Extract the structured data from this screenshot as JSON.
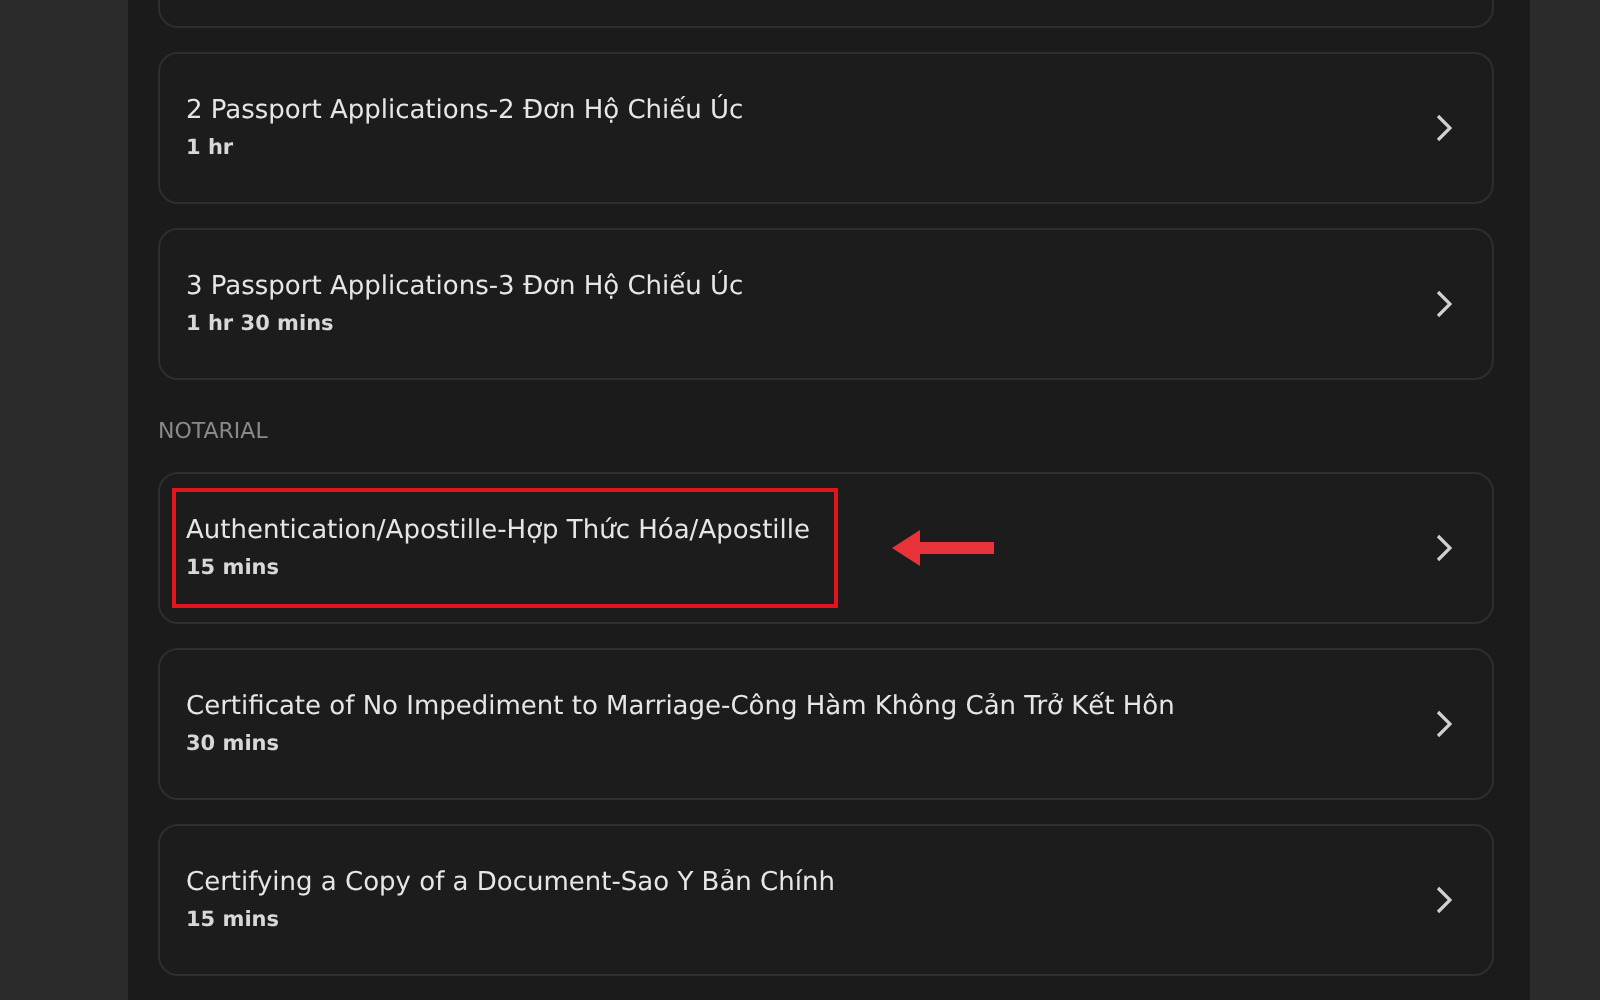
{
  "list": [
    {
      "kind": "service",
      "title": "2 Passport Applications-2 Đơn Hộ Chiếu Úc",
      "duration": "1 hr",
      "highlighted": false
    },
    {
      "kind": "service",
      "title": "3 Passport Applications-3 Đơn Hộ Chiếu Úc",
      "duration": "1 hr 30 mins",
      "highlighted": false
    },
    {
      "kind": "section",
      "title": "NOTARIAL"
    },
    {
      "kind": "service",
      "title": "Authentication/Apostille-Hợp Thức Hóa/Apostille",
      "duration": "15 mins",
      "highlighted": true
    },
    {
      "kind": "service",
      "title": "Certificate of No Impediment to Marriage-Công Hàm Không Cản Trở Kết Hôn",
      "duration": "30 mins",
      "highlighted": false
    },
    {
      "kind": "service",
      "title": "Certifying a Copy of a Document-Sao Y Bản Chính",
      "duration": "15 mins",
      "highlighted": false
    }
  ]
}
